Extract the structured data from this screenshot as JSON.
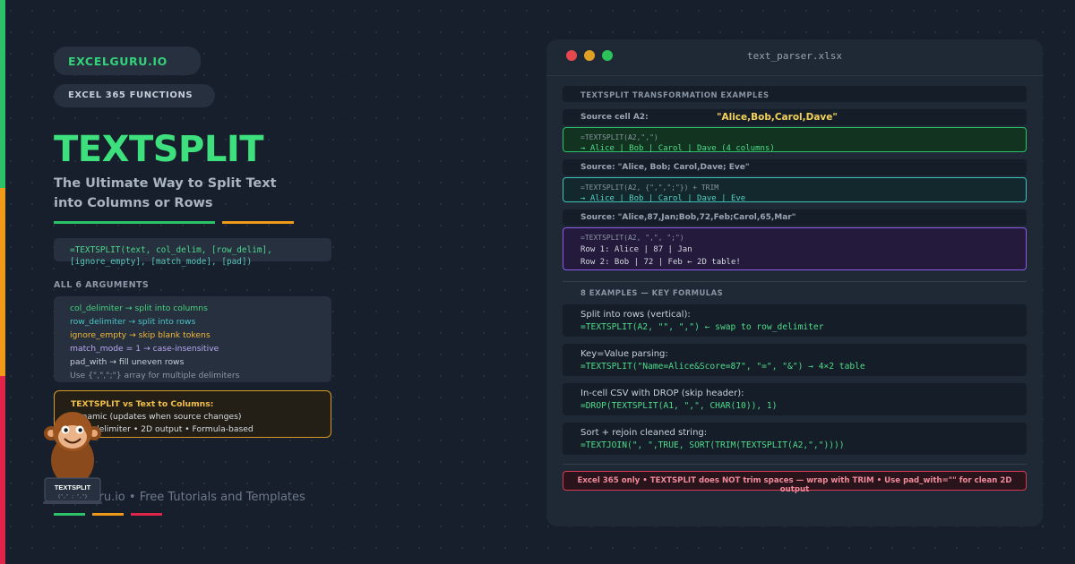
{
  "brand": "EXCELGURU.IO",
  "category": "EXCEL 365 FUNCTIONS",
  "title": "TEXTSPLIT",
  "subtitle": "The Ultimate Way to Split Text into Columns or Rows",
  "syntax": {
    "line1": "=TEXTSPLIT(text, col_delim, [row_delim],",
    "line2": "[ignore_empty], [match_mode], [pad])"
  },
  "arguments": {
    "title": "ALL 6 ARGUMENTS",
    "items": [
      "col_delimiter → split into columns",
      "row_delimiter → split into rows",
      "ignore_empty → skip blank tokens",
      "match_mode = 1 → case-insensitive",
      "pad_with → fill uneven rows",
      "Use {\",\",\";\"} array for multiple delimiters"
    ]
  },
  "comparison": {
    "heading": "TEXTSPLIT vs Text to Columns:",
    "line1": "Dynamic (updates when source changes)",
    "line2": "Multi-delimiter • 2D output • Formula-based"
  },
  "mascot_label": "TEXTSPLIT",
  "footer": "excelguru.io • Free Tutorials and Templates",
  "window": {
    "title": "text_parser.xlsx",
    "section1": "TEXTSPLIT TRANSFORMATION EXAMPLES",
    "examples": [
      {
        "source_label": "Source cell A2:",
        "source_value": "\"Alice,Bob,Carol,Dave\"",
        "formula": "=TEXTSPLIT(A2,\",\")",
        "output": "→ Alice | Bob | Carol | Dave (4 columns)"
      },
      {
        "source_label": "Source: \"Alice, Bob; Carol,Dave; Eve\"",
        "formula": "=TEXTSPLIT(A2, {\",\",\";\"}) + TRIM",
        "output": "→ Alice | Bob | Carol | Dave | Eve"
      },
      {
        "source_label": "Source: \"Alice,87,Jan;Bob,72,Feb;Carol,65,Mar\"",
        "formula": "=TEXTSPLIT(A2, \",\", \";\")",
        "output1": "Row 1: Alice | 87 | Jan",
        "output2": "Row 2: Bob | 72 | Feb ← 2D table!"
      }
    ],
    "section2": "8 EXAMPLES — KEY FORMULAS",
    "key_formulas": [
      {
        "desc": "Split into rows (vertical):",
        "formula": "=TEXTSPLIT(A2, \"\", \",\") ← swap to row_delimiter"
      },
      {
        "desc": "Key=Value parsing:",
        "formula": "=TEXTSPLIT(\"Name=Alice&Score=87\", \"=\", \"&\") → 4×2 table"
      },
      {
        "desc": "In-cell CSV with DROP (skip header):",
        "formula": "=DROP(TEXTSPLIT(A1, \",\", CHAR(10)), 1)"
      },
      {
        "desc": "Sort + rejoin cleaned string:",
        "formula": "=TEXTJOIN(\", \",TRUE, SORT(TRIM(TEXTSPLIT(A2,\",\"))))"
      }
    ],
    "warning": "Excel 365 only • TEXTSPLIT does NOT trim spaces — wrap with TRIM • Use pad_with=\"\" for clean 2D output"
  },
  "colors": {
    "accent_green": "#3ee07e",
    "accent_orange": "#f09a1a",
    "accent_red": "#e0244a",
    "background": "#161f2b"
  }
}
